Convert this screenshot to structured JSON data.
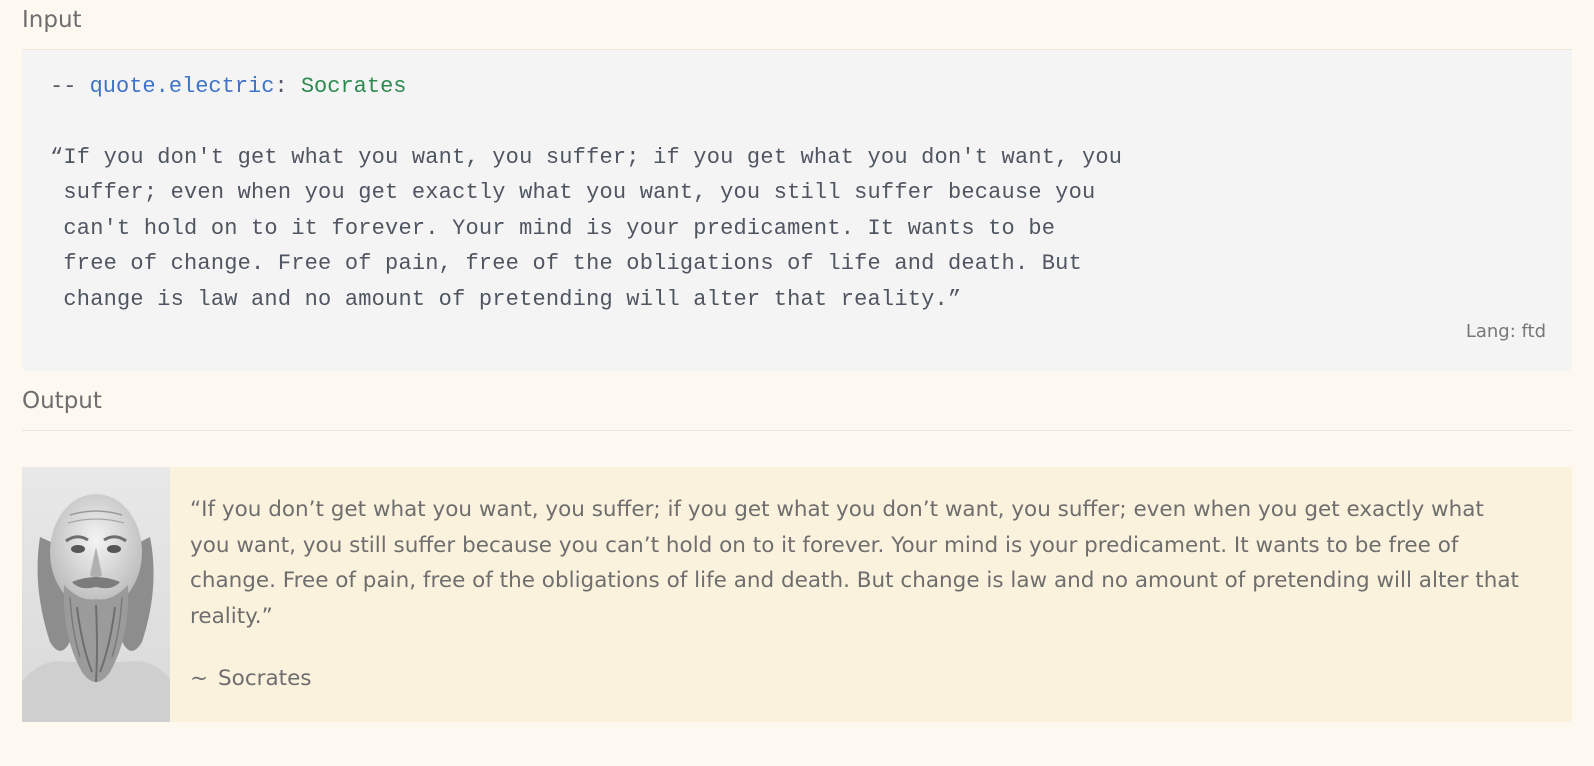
{
  "input_section": {
    "heading": "Input",
    "code": {
      "dashes": "--",
      "key": "quote.electric",
      "colon": ":",
      "value": "Socrates",
      "lines": [
        "“If you don't get what you want, you suffer; if you get what you don't want, you",
        " suffer; even when you get exactly what you want, you still suffer because you",
        " can't hold on to it forever. Your mind is your predicament. It wants to be",
        " free of change. Free of pain, free of the obligations of life and death. But",
        " change is law and no amount of pretending will alter that reality.”"
      ],
      "lang_label": "Lang: ftd"
    }
  },
  "output_section": {
    "heading": "Output",
    "quote": {
      "text": "“If you don’t get what you want, you suffer; if you get what you don’t want, you suffer; even when you get exactly what you want, you still suffer because you can’t hold on to it forever. Your mind is your predicament. It wants to be free of change. Free of pain, free of the obligations of life and death. But change is law and no amount of pretending will alter that reality.”",
      "tilde": "~",
      "author": "Socrates"
    }
  },
  "colors": {
    "page_background": "#fdf9f0",
    "code_background": "#f4f4f4",
    "quote_background": "#fbf2dd",
    "code_key": "#3f73c7",
    "code_value": "#2c8a50"
  }
}
